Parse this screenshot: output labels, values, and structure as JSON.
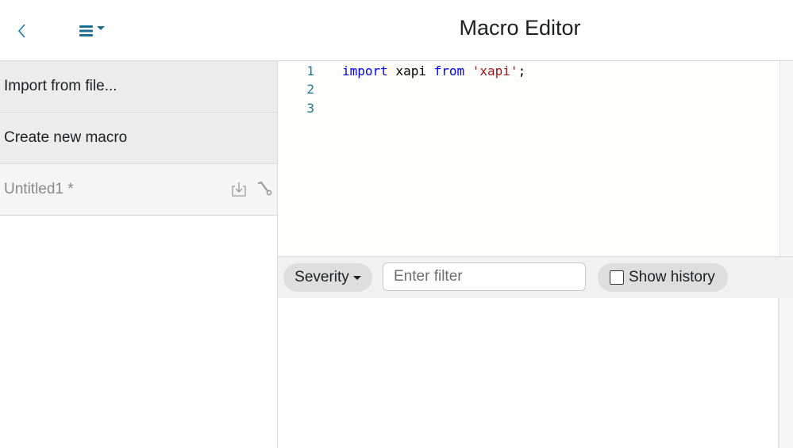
{
  "header": {
    "title": "Macro Editor",
    "back_icon": "chevron-left-icon",
    "menu_icon": "hamburger-menu-icon",
    "accent_color": "#1a7aa8"
  },
  "sidebar": {
    "items": [
      {
        "label": "Import from file..."
      },
      {
        "label": "Create new macro"
      }
    ],
    "macros": [
      {
        "name": "Untitled1 *",
        "actions": [
          "download-icon",
          "wrench-icon"
        ]
      }
    ]
  },
  "editor": {
    "lines": [
      {
        "number": "1",
        "tokens": [
          {
            "text": "import",
            "type": "kw"
          },
          {
            "text": " xapi ",
            "type": "plain"
          },
          {
            "text": "from",
            "type": "kw"
          },
          {
            "text": " ",
            "type": "plain"
          },
          {
            "text": "'xapi'",
            "type": "str"
          },
          {
            "text": ";",
            "type": "plain"
          }
        ]
      },
      {
        "number": "2",
        "tokens": []
      },
      {
        "number": "3",
        "tokens": []
      }
    ]
  },
  "log_toolbar": {
    "severity_label": "Severity",
    "filter_placeholder": "Enter filter",
    "filter_value": "",
    "show_history_label": "Show history",
    "show_history_checked": false
  }
}
